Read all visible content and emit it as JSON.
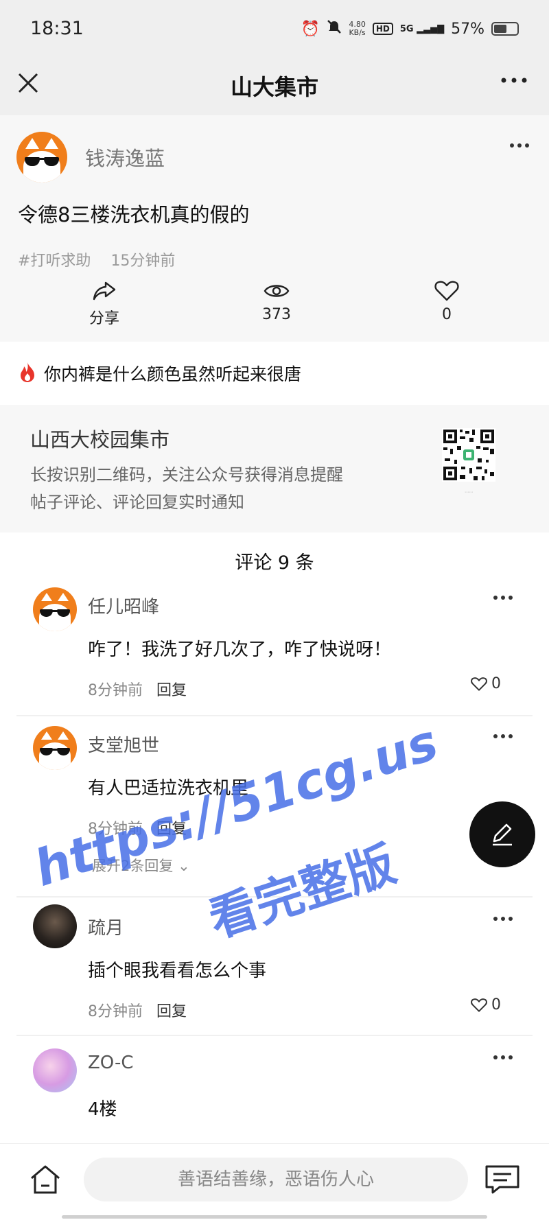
{
  "status_bar": {
    "time": "18:31",
    "net_speed_value": "4.80",
    "net_speed_unit": "KB/s",
    "hd_label": "HD",
    "signal_label": "5G",
    "battery_text": "57%",
    "battery_level": 0.57
  },
  "nav": {
    "title": "山大集市"
  },
  "post": {
    "author": "钱涛逸蓝",
    "title": "令德8三楼洗衣机真的假的",
    "tag": "#打听求助",
    "time": "15分钟前",
    "share_label": "分享",
    "views": "373",
    "likes": "0"
  },
  "hot_topic": {
    "text": "你内裤是什么颜色虽然听起来很唐"
  },
  "promo": {
    "title": "山西大校园集市",
    "line1": "长按识别二维码，关注公众号获得消息提醒",
    "line2": "帖子评论、评论回复实时通知"
  },
  "comments_header": "评论 9 条",
  "comments": [
    {
      "author": "任儿昭峰",
      "text": "咋了！我洗了好几次了，咋了快说呀！",
      "time": "8分钟前",
      "reply_label": "回复",
      "likes": "0"
    },
    {
      "author": "支堂旭世",
      "text": "有人巴适拉洗衣机里",
      "time": "8分钟前",
      "reply_label": "回复",
      "expand_label": "展开2条回复"
    },
    {
      "author": "疏月",
      "text": "插个眼我看看怎么个事",
      "time": "8分钟前",
      "reply_label": "回复",
      "likes": "0"
    },
    {
      "author": "ZO-C",
      "text": "4楼"
    }
  ],
  "watermark": {
    "line1": "https://51cg.us",
    "line2": "看完整版"
  },
  "bottom_bar": {
    "input_placeholder": "善语结善缘，恶语伤人心"
  },
  "colors": {
    "nav_background": "#efefef",
    "post_background": "#f7f7f7",
    "avatar_orange": "#f07e1b",
    "watermark_blue": "#466ee6",
    "fab_black": "#111111",
    "hot_red": "#e8352b"
  },
  "icons": {
    "close": "close-icon",
    "more": "more-icon",
    "share": "share-icon",
    "views": "eye-icon",
    "like": "heart-icon",
    "hot": "fire-icon",
    "compose": "pencil-icon",
    "home": "home-icon",
    "message": "message-icon"
  }
}
